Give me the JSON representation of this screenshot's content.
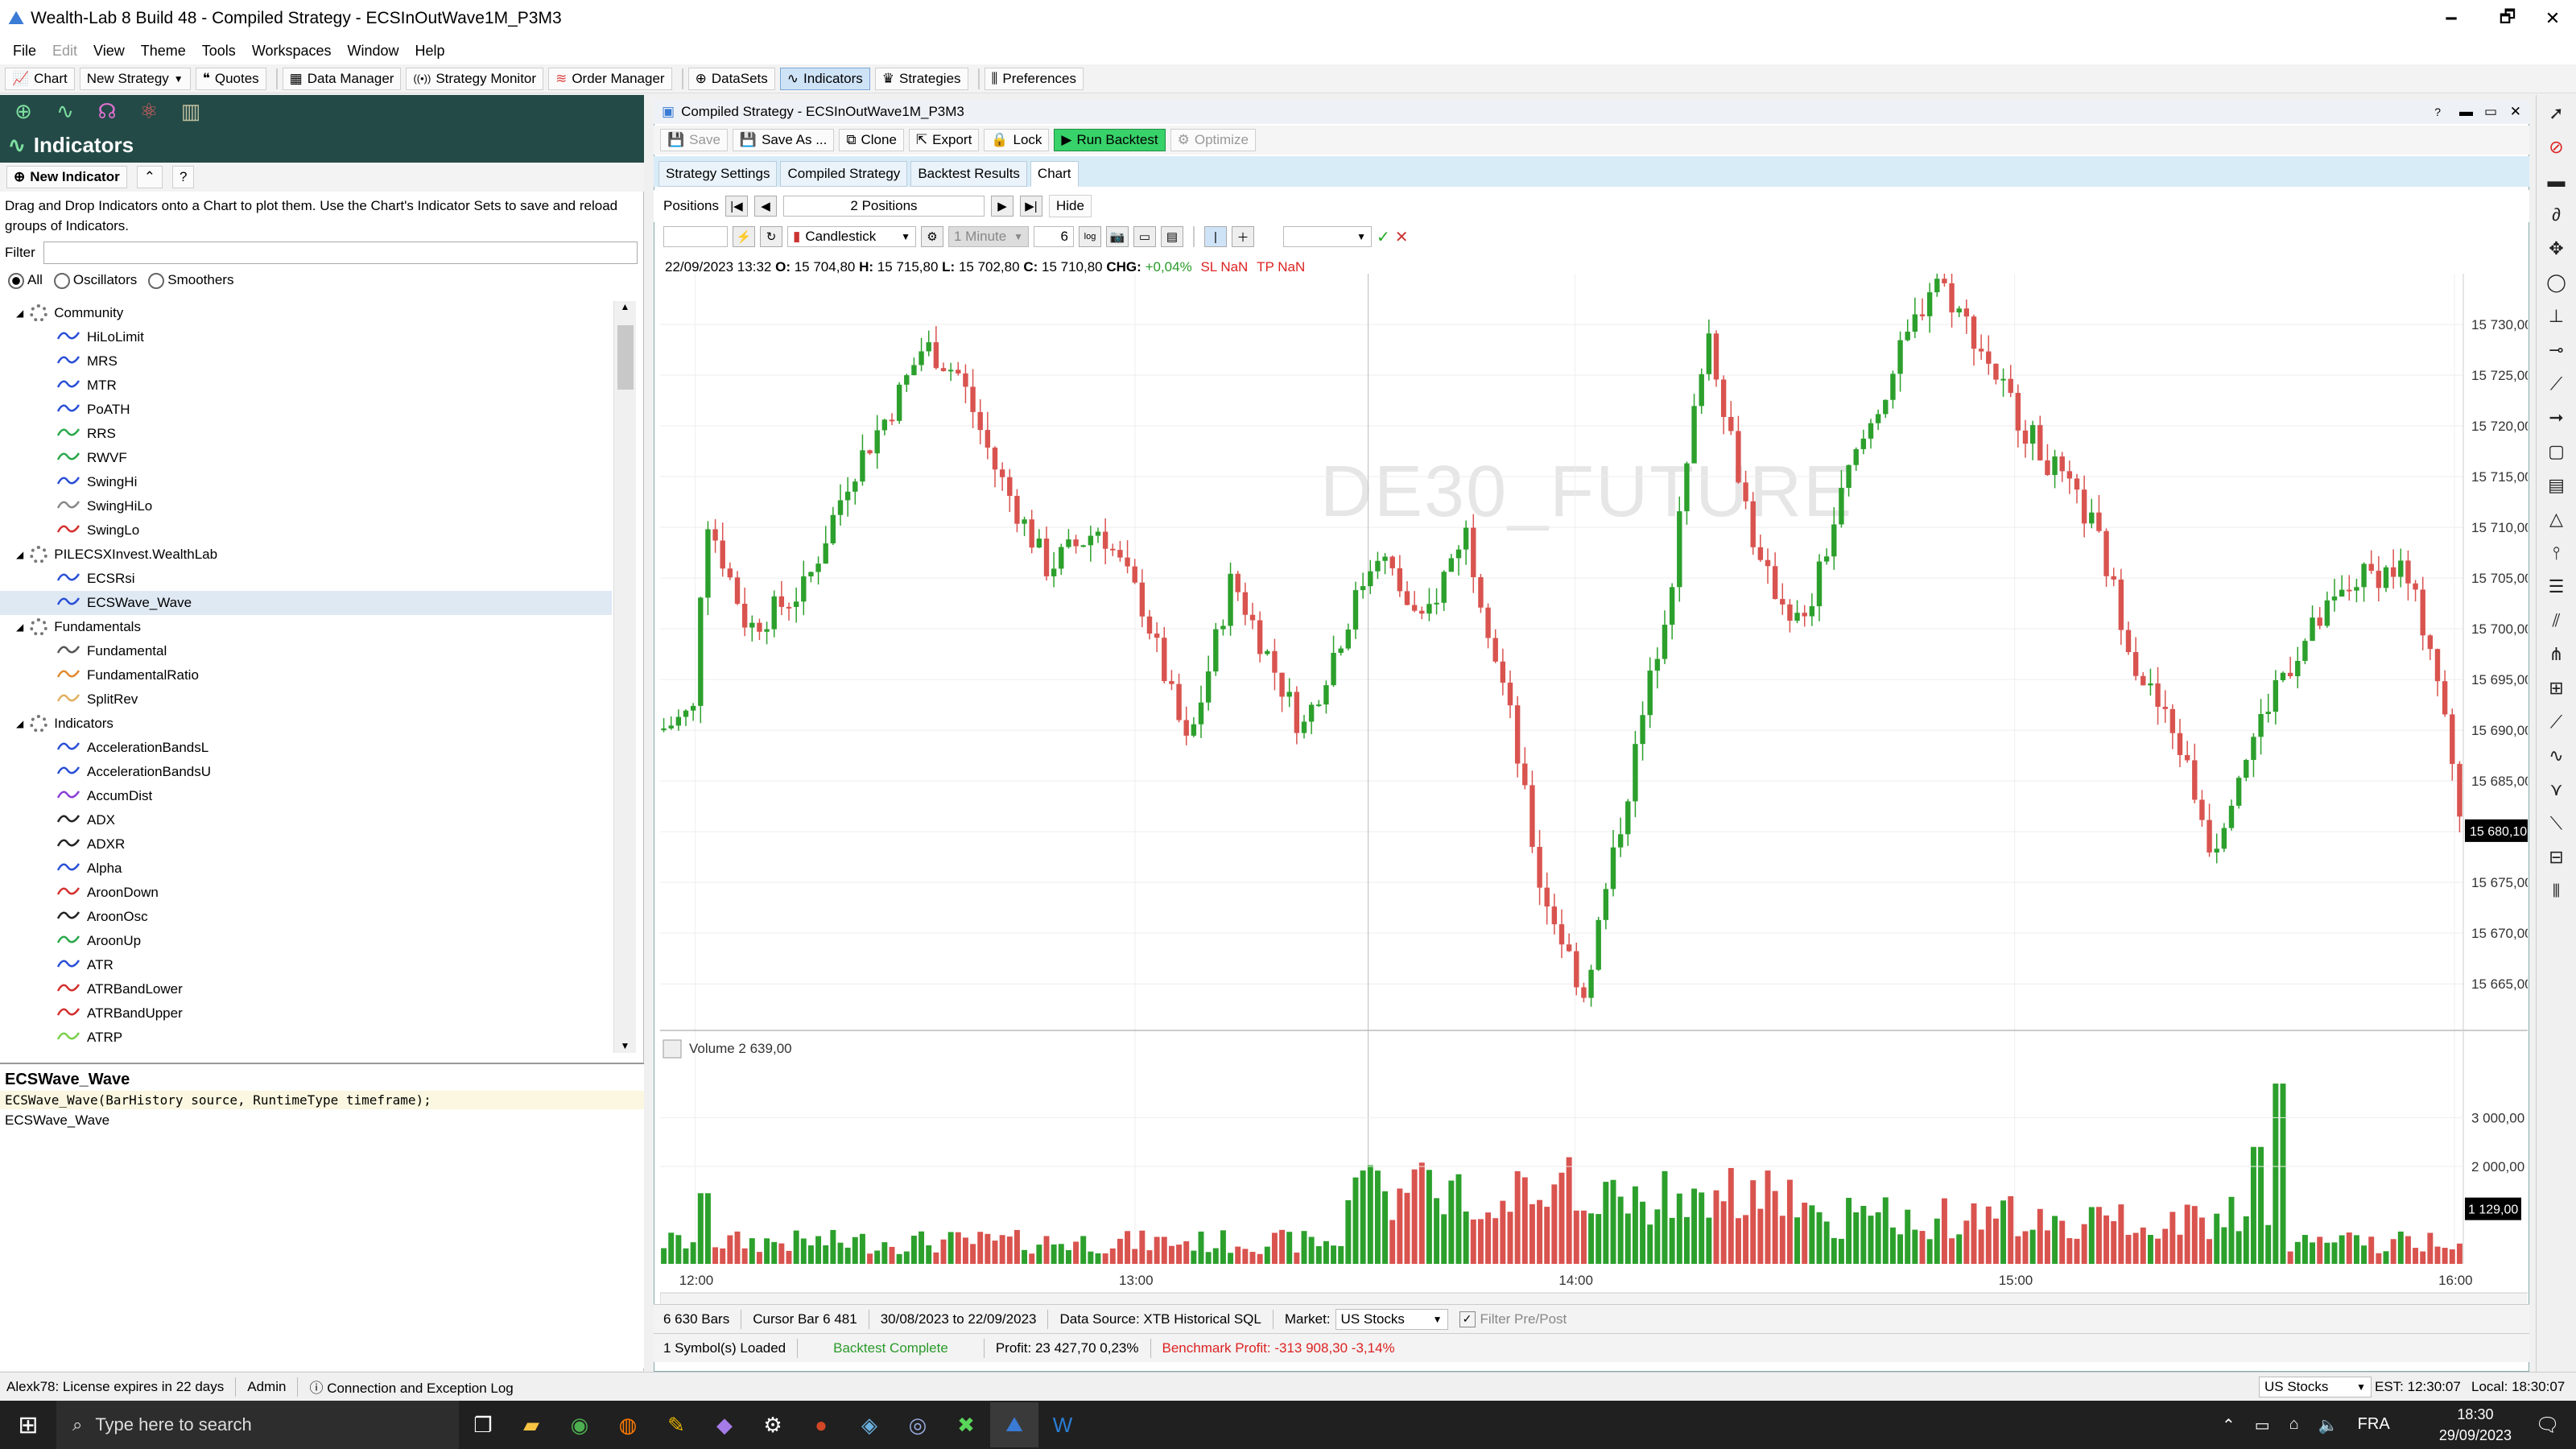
{
  "window": {
    "title": "Wealth-Lab 8 Build 48 - Compiled Strategy - ECSInOutWave1M_P3M3",
    "minimize": "🗕",
    "restore": "🗗",
    "close": "✕"
  },
  "menu": [
    "File",
    "Edit",
    "View",
    "Theme",
    "Tools",
    "Workspaces",
    "Window",
    "Help"
  ],
  "toolbar": [
    {
      "label": "Chart",
      "icon": "📈"
    },
    {
      "label": "New Strategy",
      "icon": ""
    },
    {
      "label": "Quotes",
      "icon": "❝"
    },
    {
      "label": "Data Manager",
      "icon": "▦"
    },
    {
      "label": "Strategy Monitor",
      "icon": "((•))"
    },
    {
      "label": "Order Manager",
      "icon": "≋"
    },
    {
      "label": "DataSets",
      "icon": "⊕"
    },
    {
      "label": "Indicators",
      "icon": "∿"
    },
    {
      "label": "Strategies",
      "icon": "♛"
    },
    {
      "label": "Preferences",
      "icon": "⫼"
    }
  ],
  "left": {
    "title": "Indicators",
    "new_indicator": "New Indicator",
    "help": "?",
    "description": "Drag and Drop Indicators onto a Chart to plot them. Use the Chart's Indicator Sets to save and reload groups of Indicators.",
    "filter_label": "Filter",
    "radios": [
      "All",
      "Oscillators",
      "Smoothers"
    ],
    "groups": [
      {
        "name": "Community",
        "items": [
          {
            "label": "HiLoLimit",
            "color": "#2a4fd6"
          },
          {
            "label": "MRS",
            "color": "#2a4fd6"
          },
          {
            "label": "MTR",
            "color": "#2a4fd6"
          },
          {
            "label": "PoATH",
            "color": "#2a4fd6"
          },
          {
            "label": "RRS",
            "color": "#2aa84a"
          },
          {
            "label": "RWVF",
            "color": "#2aa84a"
          },
          {
            "label": "SwingHi",
            "color": "#2a4fd6"
          },
          {
            "label": "SwingHiLo",
            "color": "#888888"
          },
          {
            "label": "SwingLo",
            "color": "#d43030"
          }
        ]
      },
      {
        "name": "PILECSXInvest.WealthLab",
        "items": [
          {
            "label": "ECSRsi",
            "color": "#2a4fd6"
          },
          {
            "label": "ECSWave_Wave",
            "color": "#2a4fd6",
            "selected": true
          }
        ]
      },
      {
        "name": "Fundamentals",
        "items": [
          {
            "label": "Fundamental",
            "color": "#555555"
          },
          {
            "label": "FundamentalRatio",
            "color": "#e08a30"
          },
          {
            "label": "SplitRev",
            "color": "#e0b060"
          }
        ]
      },
      {
        "name": "Indicators",
        "items": [
          {
            "label": "AccelerationBandsL",
            "color": "#2a4fd6"
          },
          {
            "label": "AccelerationBandsU",
            "color": "#2a4fd6"
          },
          {
            "label": "AccumDist",
            "color": "#8a3fd6"
          },
          {
            "label": "ADX",
            "color": "#222222"
          },
          {
            "label": "ADXR",
            "color": "#222222"
          },
          {
            "label": "Alpha",
            "color": "#2a4fd6"
          },
          {
            "label": "AroonDown",
            "color": "#d43030"
          },
          {
            "label": "AroonOsc",
            "color": "#222222"
          },
          {
            "label": "AroonUp",
            "color": "#2aa84a"
          },
          {
            "label": "ATR",
            "color": "#2a4fd6"
          },
          {
            "label": "ATRBandLower",
            "color": "#d43030"
          },
          {
            "label": "ATRBandUpper",
            "color": "#d43030"
          },
          {
            "label": "ATRP",
            "color": "#7ad04a"
          }
        ]
      }
    ],
    "detail": {
      "name": "ECSWave_Wave",
      "signature": "ECSWave_Wave(BarHistory source, RuntimeType timeframe);",
      "desc": "ECSWave_Wave"
    }
  },
  "doc": {
    "title": "Compiled Strategy - ECSInOutWave1M_P3M3",
    "buttons": [
      "Save",
      "Save As ...",
      "Clone",
      "Export",
      "Lock",
      "Run Backtest",
      "Optimize"
    ],
    "tabs": [
      "Strategy Settings",
      "Compiled Strategy",
      "Backtest Results",
      "Chart"
    ],
    "positions_label": "Positions",
    "positions_value": "2 Positions",
    "hide": "Hide",
    "chart_style": "Candlestick",
    "timeframe": "1 Minute",
    "scale_value": "6",
    "log": "log"
  },
  "chart_info": {
    "date": "22/09/2023 13:32",
    "o": "15 704,80",
    "h": "15 715,80",
    "l": "15 702,80",
    "c": "15 710,80",
    "chg": "+0,04%",
    "sl": "SL NaN",
    "tp": "TP NaN"
  },
  "watermark": "DE30_FUTURE",
  "chart_data": {
    "type": "candlestick",
    "price_ticks": [
      "15 730,00",
      "15 725,00",
      "15 720,00",
      "15 715,00",
      "15 710,00",
      "15 705,00",
      "15 700,00",
      "15 695,00",
      "15 690,00",
      "15 685,00",
      "15 680,00",
      "15 675,00",
      "15 670,00",
      "15 665,00"
    ],
    "price_range": [
      15662,
      15735
    ],
    "last_price": "15 680,10",
    "volume_label": "Volume 2 639,00",
    "volume_ticks": [
      "3 000,00",
      "2 000,00"
    ],
    "volume_last": "1 129,00",
    "volume_range": [
      0,
      3800
    ],
    "time_ticks": [
      "12:00",
      "13:00",
      "14:00",
      "15:00",
      "16:00"
    ],
    "time_range": [
      11.92,
      16.02
    ],
    "keypoints": [
      [
        11.92,
        15690
      ],
      [
        12.0,
        15692
      ],
      [
        12.02,
        15712
      ],
      [
        12.12,
        15700
      ],
      [
        12.25,
        15704
      ],
      [
        12.35,
        15715
      ],
      [
        12.45,
        15722
      ],
      [
        12.52,
        15728
      ],
      [
        12.6,
        15725
      ],
      [
        12.68,
        15716
      ],
      [
        12.8,
        15706
      ],
      [
        12.92,
        15710
      ],
      [
        13.02,
        15702
      ],
      [
        13.12,
        15688
      ],
      [
        13.22,
        15705
      ],
      [
        13.38,
        15690
      ],
      [
        13.55,
        15708
      ],
      [
        13.65,
        15700
      ],
      [
        13.75,
        15710
      ],
      [
        13.85,
        15692
      ],
      [
        13.92,
        15675
      ],
      [
        14.02,
        15664
      ],
      [
        14.1,
        15680
      ],
      [
        14.22,
        15705
      ],
      [
        14.3,
        15730
      ],
      [
        14.42,
        15706
      ],
      [
        14.52,
        15700
      ],
      [
        14.62,
        15715
      ],
      [
        14.72,
        15725
      ],
      [
        14.82,
        15735
      ],
      [
        14.92,
        15728
      ],
      [
        15.02,
        15720
      ],
      [
        15.1,
        15715
      ],
      [
        15.18,
        15710
      ],
      [
        15.28,
        15696
      ],
      [
        15.38,
        15688
      ],
      [
        15.45,
        15678
      ],
      [
        15.5,
        15685
      ],
      [
        15.6,
        15695
      ],
      [
        15.68,
        15700
      ],
      [
        15.78,
        15705
      ],
      [
        15.88,
        15706
      ],
      [
        15.95,
        15698
      ],
      [
        16.02,
        15680
      ]
    ]
  },
  "status1": {
    "bars": "6 630 Bars",
    "cursor": "Cursor Bar 6 481",
    "range": "30/08/2023 to 22/09/2023",
    "source": "Data Source: XTB Historical SQL",
    "market_label": "Market:",
    "market": "US Stocks",
    "filter": "Filter Pre/Post"
  },
  "status2": {
    "symbols": "1 Symbol(s) Loaded",
    "complete": "Backtest Complete",
    "profit": "Profit: 23 427,70 0,23%",
    "bench": "Benchmark Profit: -313 908,30 -3,14%"
  },
  "bottom": {
    "license": "Alexk78: License expires in 22 days",
    "admin": "Admin",
    "log": "Connection and Exception Log",
    "market": "US Stocks",
    "est": "EST: 12:30:07",
    "local": "Local: 18:30:07"
  },
  "taskbar": {
    "search": "Type here to search",
    "lang": "FRA",
    "time": "18:30",
    "date": "29/09/2023"
  }
}
